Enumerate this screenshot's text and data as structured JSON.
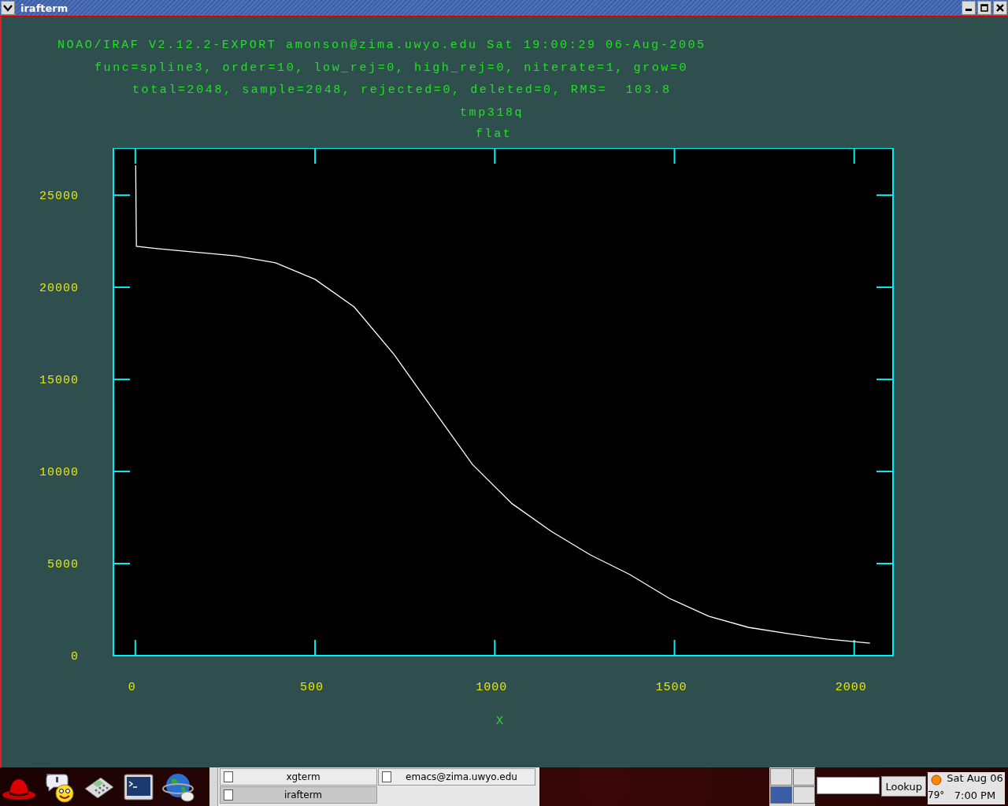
{
  "window": {
    "title": "irafterm"
  },
  "header": [
    "NOAO/IRAF V2.12.2-EXPORT amonson@zima.uwyo.edu Sat 19:00:29 06-Aug-2005",
    "func=spline3, order=10, low_rej=0, high_rej=0, niterate=1, grow=0",
    "total=2048, sample=2048, rejected=0, deleted=0, RMS=  103.8",
    "tmp318q"
  ],
  "plot": {
    "chart_data": {
      "type": "line",
      "title": "flat",
      "xlabel": "X",
      "x": [
        1,
        3,
        61,
        280,
        390,
        500,
        609,
        719,
        828,
        938,
        1048,
        1157,
        1266,
        1376,
        1485,
        1595,
        1705,
        1814,
        1924,
        2044
      ],
      "series": [
        {
          "color": "#ffffff",
          "values": [
            26620,
            22220,
            22100,
            21700,
            21330,
            20430,
            18930,
            16370,
            13380,
            10380,
            8250,
            6750,
            5470,
            4400,
            3120,
            2140,
            1540,
            1200,
            900,
            680
          ]
        }
      ],
      "xlim": [
        -61,
        2108
      ],
      "ylim": [
        0,
        27560
      ],
      "xticks": [
        0,
        500,
        1000,
        1500,
        2000
      ],
      "yticks": [
        0,
        5000,
        10000,
        15000,
        20000,
        25000
      ]
    }
  },
  "taskbar": {
    "tasks": [
      {
        "label": "xgterm",
        "selected": false
      },
      {
        "label": "emacs@zima.uwyo.edu",
        "selected": false
      },
      {
        "label": "irafterm",
        "selected": true
      }
    ],
    "workspaces": [
      {
        "selected": false
      },
      {
        "selected": false
      },
      {
        "selected": true
      },
      {
        "selected": false
      }
    ],
    "lookup_button": "Lookup",
    "temperature": "79°",
    "date": "Sat Aug 06",
    "time": "7:00 PM"
  }
}
